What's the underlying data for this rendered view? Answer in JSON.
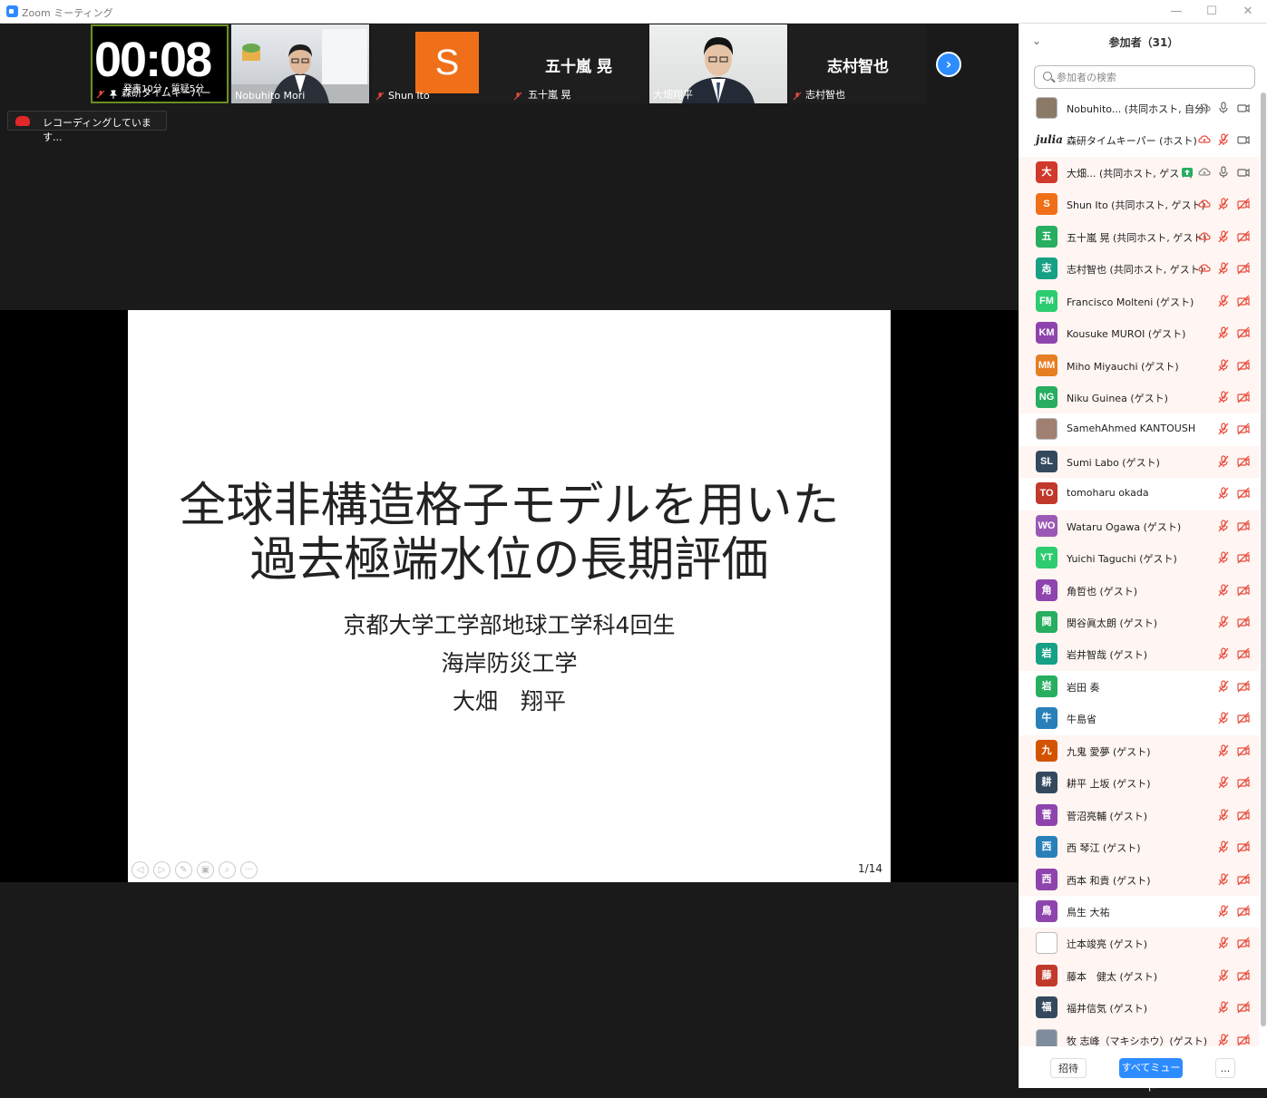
{
  "window": {
    "title": "Zoom ミーティング",
    "minimize": "—",
    "maximize": "☐",
    "close": "✕"
  },
  "timer": {
    "value": "00:08",
    "sub": "発表10分・質疑5分"
  },
  "tiles": [
    {
      "label": "森研タイムキーパー"
    },
    {
      "label": "Nobuhito Mori"
    },
    {
      "label": "Shun Ito",
      "initial": "S"
    },
    {
      "label": "五十嵐 晃",
      "big": "五十嵐 晃"
    },
    {
      "label": "大畑翔平"
    },
    {
      "label": "志村智也",
      "big": "志村智也"
    }
  ],
  "next_button": "›",
  "recording": {
    "text": "レコーディングしています..."
  },
  "slide": {
    "title_line1": "全球非構造格子モデルを用いた",
    "title_line2": "過去極端水位の長期評価",
    "sub1": "京都大学工学部地球工学科4回生",
    "sub2": "海岸防災工学",
    "sub3": "大畑　翔平",
    "page": "1/14",
    "controls": [
      "◁",
      "▷",
      "✎",
      "▣",
      "⌕",
      "···"
    ]
  },
  "panel": {
    "collapse": "⌄",
    "title": "参加者（31）",
    "search_placeholder": "参加者の検索",
    "participants": [
      {
        "initial": "",
        "color": "#8a7a66",
        "name": "Nobuhito... (共同ホスト, 自分)",
        "mic": "on",
        "cam": "on",
        "bg": "white"
      },
      {
        "initial": "julia",
        "color": "#ffffff",
        "name": "森研タイムキーパー (ホスト)",
        "mic": "off",
        "cam": "on",
        "bg": "white"
      },
      {
        "initial": "大",
        "color": "#d0392b",
        "name": "大畑... (共同ホスト, ゲスト)",
        "mic": "on",
        "cam": "on",
        "bg": "pink"
      },
      {
        "initial": "S",
        "color": "#f07019",
        "name": "Shun Ito (共同ホスト, ゲスト)",
        "mic": "off",
        "cam": "off",
        "bg": "pink"
      },
      {
        "initial": "五",
        "color": "#27ae60",
        "name": "五十嵐 晃 (共同ホスト, ゲスト)",
        "mic": "off",
        "cam": "off",
        "bg": "pink"
      },
      {
        "initial": "志",
        "color": "#16a085",
        "name": "志村智也 (共同ホスト, ゲスト)",
        "mic": "off",
        "cam": "off",
        "bg": "pink"
      },
      {
        "initial": "FM",
        "color": "#2ecc71",
        "name": "Francisco Molteni (ゲスト)",
        "mic": "off",
        "cam": "off",
        "bg": "pink"
      },
      {
        "initial": "KM",
        "color": "#8e44ad",
        "name": "Kousuke MUROI (ゲスト)",
        "mic": "off",
        "cam": "off",
        "bg": "pink"
      },
      {
        "initial": "MM",
        "color": "#e67e22",
        "name": "Miho Miyauchi (ゲスト)",
        "mic": "off",
        "cam": "off",
        "bg": "pink"
      },
      {
        "initial": "NG",
        "color": "#27ae60",
        "name": "Niku Guinea (ゲスト)",
        "mic": "off",
        "cam": "off",
        "bg": "pink"
      },
      {
        "initial": "",
        "color": "#a08070",
        "name": "SamehAhmed KANTOUSH",
        "mic": "off",
        "cam": "off",
        "bg": "white"
      },
      {
        "initial": "SL",
        "color": "#34495e",
        "name": "Sumi Labo (ゲスト)",
        "mic": "off",
        "cam": "off",
        "bg": "pink"
      },
      {
        "initial": "TO",
        "color": "#c0392b",
        "name": "tomoharu okada",
        "mic": "off",
        "cam": "off",
        "bg": "white"
      },
      {
        "initial": "WO",
        "color": "#9b59b6",
        "name": "Wataru Ogawa (ゲスト)",
        "mic": "off",
        "cam": "off",
        "bg": "pink"
      },
      {
        "initial": "YT",
        "color": "#2ecc71",
        "name": "Yuichi Taguchi (ゲスト)",
        "mic": "off",
        "cam": "off",
        "bg": "pink"
      },
      {
        "initial": "角",
        "color": "#8e44ad",
        "name": "角哲也 (ゲスト)",
        "mic": "off",
        "cam": "off",
        "bg": "pink"
      },
      {
        "initial": "関",
        "color": "#27ae60",
        "name": "関谷眞太朗 (ゲスト)",
        "mic": "off",
        "cam": "off",
        "bg": "pink"
      },
      {
        "initial": "岩",
        "color": "#16a085",
        "name": "岩井智哉 (ゲスト)",
        "mic": "off",
        "cam": "off",
        "bg": "pink"
      },
      {
        "initial": "岩",
        "color": "#27ae60",
        "name": "岩田 奏",
        "mic": "off",
        "cam": "off",
        "bg": "white"
      },
      {
        "initial": "牛",
        "color": "#2980b9",
        "name": "牛島省",
        "mic": "off",
        "cam": "off",
        "bg": "white"
      },
      {
        "initial": "九",
        "color": "#d35400",
        "name": "九鬼 愛夢 (ゲスト)",
        "mic": "off",
        "cam": "off",
        "bg": "pink"
      },
      {
        "initial": "耕",
        "color": "#34495e",
        "name": "耕平 上坂 (ゲスト)",
        "mic": "off",
        "cam": "off",
        "bg": "pink"
      },
      {
        "initial": "菅",
        "color": "#8e44ad",
        "name": "菅沼亮輔 (ゲスト)",
        "mic": "off",
        "cam": "off",
        "bg": "pink"
      },
      {
        "initial": "西",
        "color": "#2980b9",
        "name": "西 琴江 (ゲスト)",
        "mic": "off",
        "cam": "off",
        "bg": "pink"
      },
      {
        "initial": "西",
        "color": "#8e44ad",
        "name": "西本 和貴 (ゲスト)",
        "mic": "off",
        "cam": "off",
        "bg": "pink"
      },
      {
        "initial": "鳥",
        "color": "#8e44ad",
        "name": "鳥生 大祐",
        "mic": "off",
        "cam": "off",
        "bg": "white"
      },
      {
        "initial": "",
        "color": "#ffffff",
        "name": "辻本竣亮 (ゲスト)",
        "mic": "off",
        "cam": "off",
        "bg": "pink"
      },
      {
        "initial": "藤",
        "color": "#c0392b",
        "name": "藤本　健太 (ゲスト)",
        "mic": "off",
        "cam": "off",
        "bg": "pink"
      },
      {
        "initial": "福",
        "color": "#34495e",
        "name": "福井信気 (ゲスト)",
        "mic": "off",
        "cam": "off",
        "bg": "pink"
      },
      {
        "initial": "",
        "color": "#7f8c9d",
        "name": "牧 志峰（マキシホウ）(ゲスト)",
        "mic": "off",
        "cam": "off",
        "bg": "pink"
      }
    ],
    "footer": {
      "invite": "招待",
      "mute_all": "すべてミュート",
      "more": "..."
    }
  }
}
